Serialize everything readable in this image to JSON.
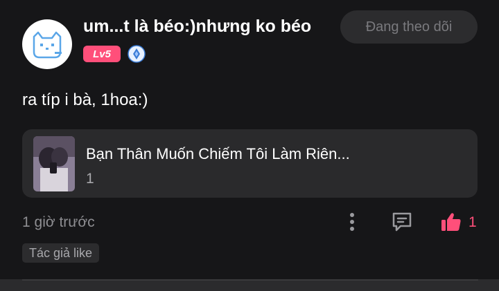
{
  "user": {
    "name": "um...t là béo:)nhưng ko béo",
    "level": "Lv5",
    "avatar_icon": "cat-avatar-icon",
    "verified_icon": "verified-diamond-icon"
  },
  "follow_button": {
    "label": "Đang theo dõi"
  },
  "post": {
    "text": "ra típ i bà, 1hoa:)"
  },
  "book": {
    "title": "Bạn Thân Muốn Chiếm Tôi Làm Riên...",
    "chapter": "1",
    "cover_icon": "book-cover-image"
  },
  "meta": {
    "timestamp": "1 giờ trước",
    "like_count": "1",
    "author_tag": "Tác giả like"
  },
  "colors": {
    "accent": "#ff4f7a",
    "background": "#161618",
    "card": "#2a2a2c",
    "muted_text": "#8e8e92"
  }
}
